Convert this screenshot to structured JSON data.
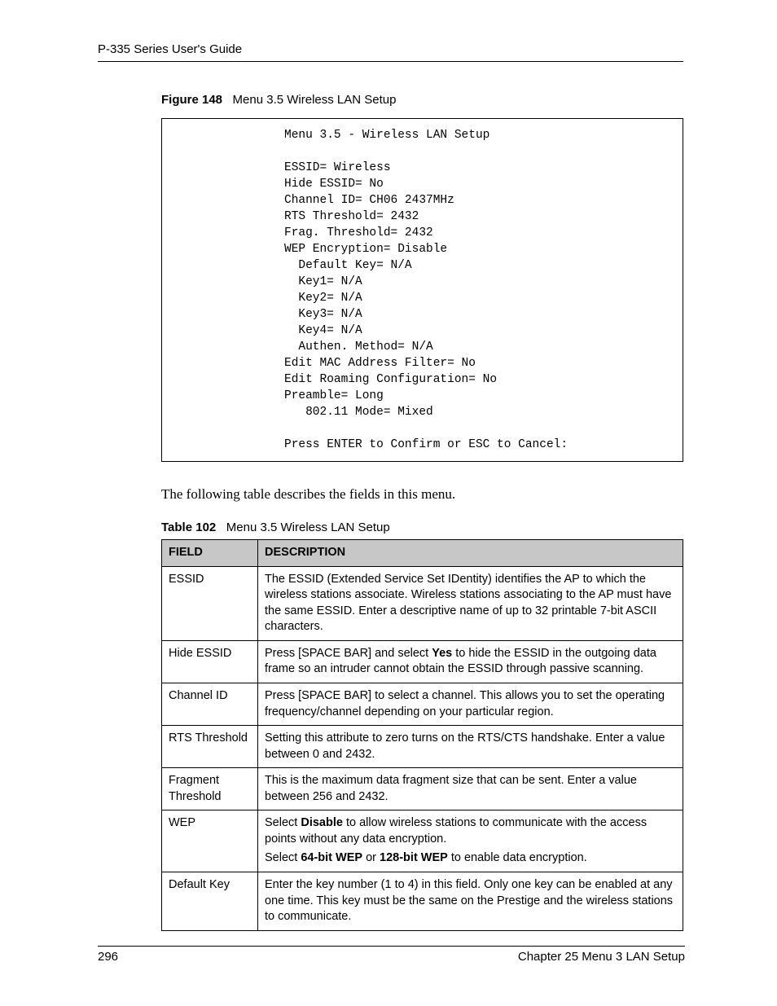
{
  "header": {
    "title": "P-335 Series User's Guide"
  },
  "figure": {
    "label": "Figure 148",
    "title": "Menu 3.5 Wireless LAN Setup"
  },
  "code": "Menu 3.5 - Wireless LAN Setup\n\nESSID= Wireless\nHide ESSID= No\nChannel ID= CH06 2437MHz\nRTS Threshold= 2432\nFrag. Threshold= 2432\nWEP Encryption= Disable\n  Default Key= N/A\n  Key1= N/A\n  Key2= N/A\n  Key3= N/A\n  Key4= N/A\n  Authen. Method= N/A\nEdit MAC Address Filter= No\nEdit Roaming Configuration= No\nPreamble= Long\n   802.11 Mode= Mixed\n\nPress ENTER to Confirm or ESC to Cancel:",
  "intro": "The following table describes the fields in this menu.",
  "table": {
    "label": "Table 102",
    "title": "Menu 3.5 Wireless LAN Setup",
    "head": {
      "c1": "FIELD",
      "c2": "DESCRIPTION"
    },
    "rows": [
      {
        "field": "ESSID",
        "desc": [
          {
            "segs": [
              {
                "t": "The ESSID (Extended Service Set IDentity) identifies the AP to which the wireless stations associate. Wireless stations associating to the AP must have the same ESSID. Enter a descriptive name of up to 32 printable 7-bit ASCII characters."
              }
            ]
          }
        ]
      },
      {
        "field": "Hide ESSID",
        "desc": [
          {
            "segs": [
              {
                "t": "Press [SPACE BAR] and select "
              },
              {
                "t": "Yes",
                "b": true
              },
              {
                "t": " to hide the ESSID in the outgoing data frame so an intruder cannot obtain the ESSID through passive scanning."
              }
            ]
          }
        ]
      },
      {
        "field": "Channel ID",
        "desc": [
          {
            "segs": [
              {
                "t": "Press [SPACE BAR] to select a channel. This allows you to set the operating frequency/channel depending on your particular region."
              }
            ]
          }
        ]
      },
      {
        "field": "RTS Threshold",
        "desc": [
          {
            "segs": [
              {
                "t": "Setting this attribute to zero turns on the RTS/CTS handshake. Enter a value between 0 and 2432."
              }
            ]
          }
        ]
      },
      {
        "field": "Fragment Threshold",
        "desc": [
          {
            "segs": [
              {
                "t": "This is the maximum data fragment size that can be sent. Enter a value between 256 and 2432."
              }
            ]
          }
        ]
      },
      {
        "field": "WEP",
        "desc": [
          {
            "segs": [
              {
                "t": "Select "
              },
              {
                "t": "Disable",
                "b": true
              },
              {
                "t": " to allow wireless stations to communicate with the access points without any data encryption."
              }
            ]
          },
          {
            "segs": [
              {
                "t": "Select "
              },
              {
                "t": "64-bit WEP",
                "b": true
              },
              {
                "t": " or "
              },
              {
                "t": "128-bit WEP",
                "b": true
              },
              {
                "t": " to enable data encryption."
              }
            ]
          }
        ]
      },
      {
        "field": "Default Key",
        "desc": [
          {
            "segs": [
              {
                "t": "Enter the key number (1 to 4) in this field. Only one key can be enabled at any one time. This key must be the same on the Prestige and the wireless stations to communicate."
              }
            ]
          }
        ]
      }
    ]
  },
  "footer": {
    "page": "296",
    "chapter": "Chapter 25 Menu 3 LAN Setup"
  }
}
